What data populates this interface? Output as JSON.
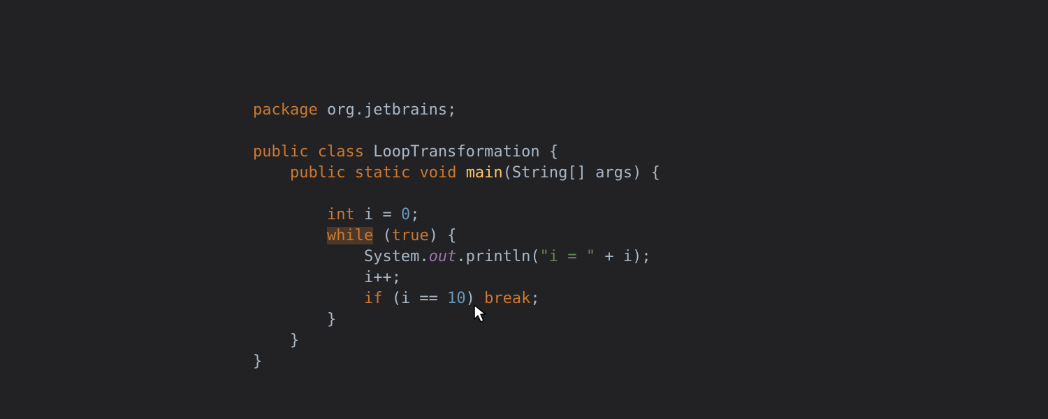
{
  "code": {
    "line1": {
      "kw_package": "package",
      "pkg": "org.jetbrains",
      "semi": ";"
    },
    "line3": {
      "kw_public": "public",
      "kw_class": "class",
      "cls": "LoopTransformation",
      "brace": " {"
    },
    "line4": {
      "kw_public": "public",
      "kw_static": "static",
      "kw_void": "void",
      "fn": "main",
      "params": "(String[] args) {"
    },
    "line6": {
      "kw_int": "int",
      "var": " i = ",
      "num": "0",
      "semi": ";"
    },
    "line7": {
      "kw_while": "while",
      "paren_open": " (",
      "kw_true": "true",
      "rest": ") {"
    },
    "line8": {
      "sys": "System.",
      "out": "out",
      "rest1": ".println(",
      "str": "\"i = \"",
      "rest2": " + i);"
    },
    "line9": {
      "txt": "i++;"
    },
    "line10": {
      "kw_if": "if",
      "cond_open": " (i == ",
      "num": "10",
      "cond_close": ") ",
      "kw_break": "break",
      "semi": ";"
    },
    "line11": {
      "brace": "}"
    },
    "line12": {
      "brace": "}"
    },
    "line13": {
      "brace": "}"
    }
  }
}
